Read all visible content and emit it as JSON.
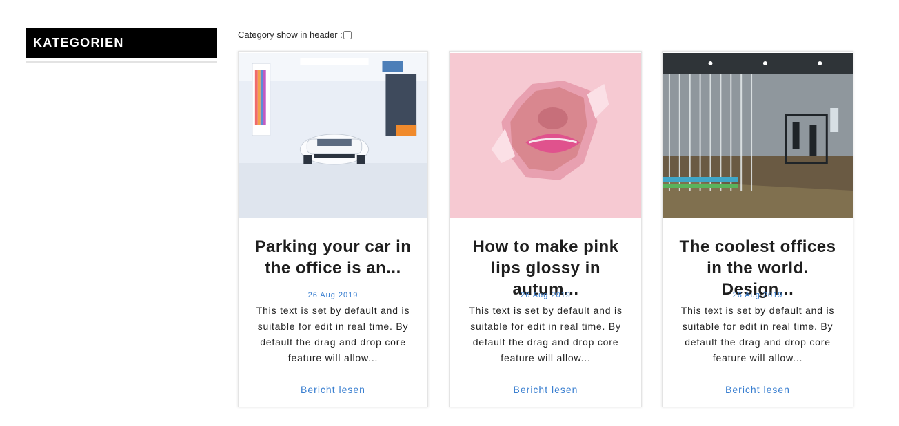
{
  "sidebar": {
    "title": "KATEGORIEN"
  },
  "header_option": {
    "label": "Category show in header :"
  },
  "posts": [
    {
      "title": "Parking your car in the office is an...",
      "date": "26 Aug 2019",
      "excerpt": "This text is set by default and is suitable for edit in real time. By default the drag and drop core feature will allow...",
      "link_label": "Bericht lesen",
      "image": "white-sports-car-showroom"
    },
    {
      "title": "How to make pink lips glossy in autum...",
      "date": "26 Aug 2019",
      "excerpt": "This text is set by default and is suitable for edit in real time. By default the drag and drop core feature will allow...",
      "link_label": "Bericht lesen",
      "image": "pink-lips-through-torn-paper"
    },
    {
      "title": "The coolest offices in the world. Design...",
      "date": "26 Aug 2019",
      "excerpt": "This text is set by default and is suitable for edit in real time. By default the drag and drop core feature will allow...",
      "link_label": "Bericht lesen",
      "image": "modern-office-interior"
    }
  ],
  "colors": {
    "accent": "#3a7fd0",
    "sidebar_bg": "#000000"
  }
}
